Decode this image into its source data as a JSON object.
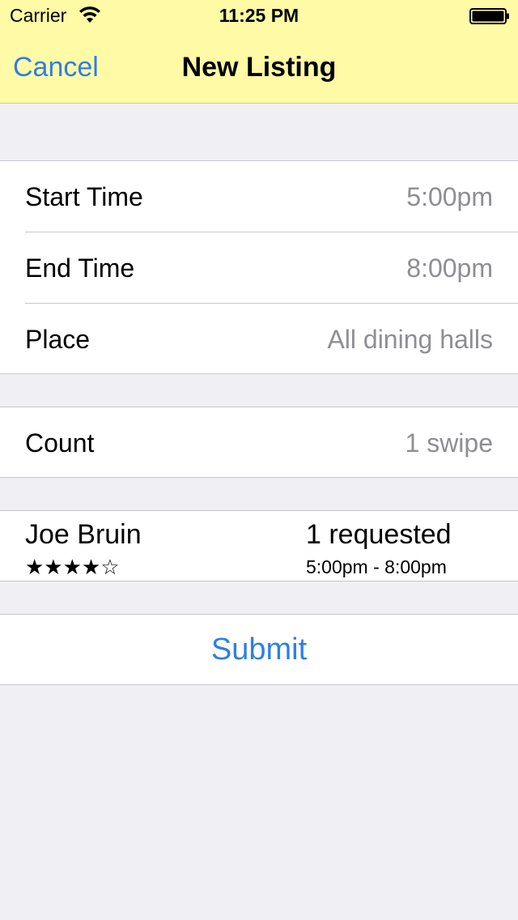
{
  "status_bar": {
    "carrier": "Carrier",
    "time": "11:25 PM"
  },
  "nav": {
    "cancel_label": "Cancel",
    "title": "New Listing"
  },
  "listing": {
    "rows": [
      {
        "label": "Start Time",
        "value": "5:00pm"
      },
      {
        "label": "End Time",
        "value": "8:00pm"
      },
      {
        "label": "Place",
        "value": "All dining halls"
      }
    ],
    "count": {
      "label": "Count",
      "value": "1 swipe"
    }
  },
  "request": {
    "name": "Joe Bruin",
    "rating_stars": "★★★★☆",
    "rating": 4,
    "rating_max": 5,
    "count_text": "1 requested",
    "times": "5:00pm - 8:00pm"
  },
  "submit_label": "Submit",
  "colors": {
    "nav_background": "#fffaa6",
    "accent": "#2f7ee8",
    "secondary_text": "#8e8e93",
    "grouped_background": "#efeff4"
  }
}
